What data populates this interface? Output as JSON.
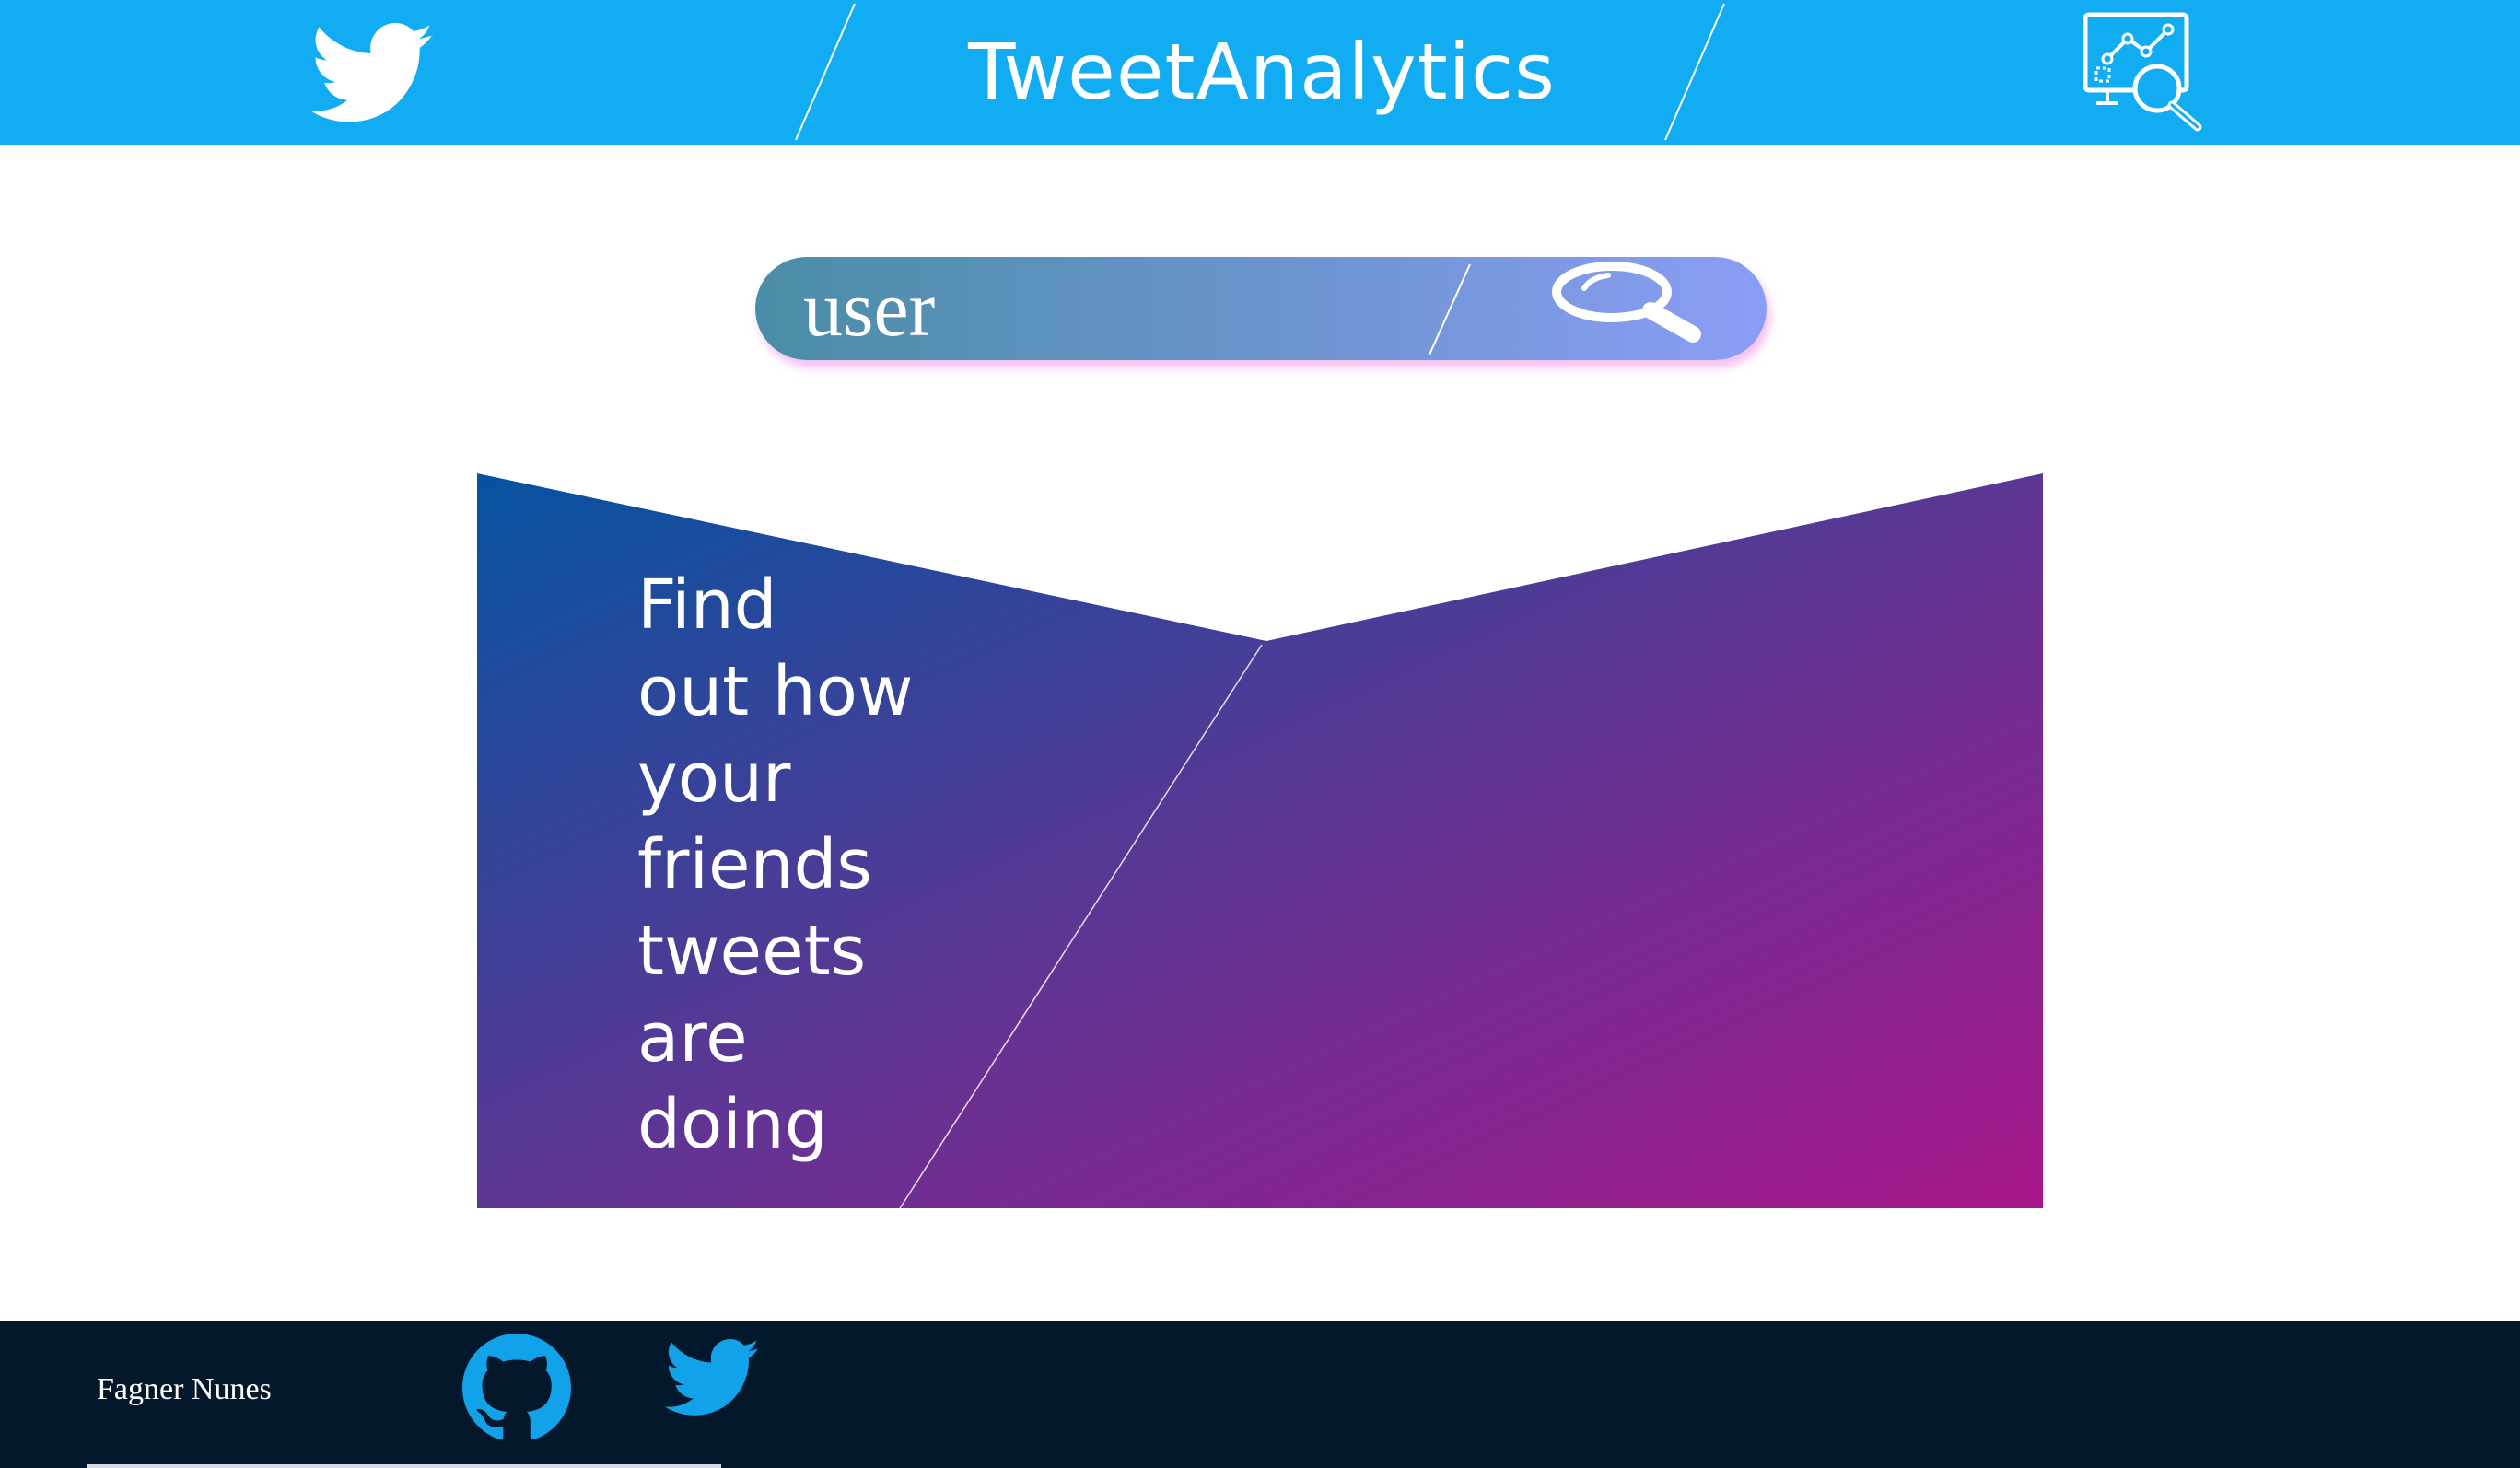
{
  "header": {
    "title": "TweetAnalytics",
    "logo_icon": "twitter-bird-icon",
    "right_icon": "analytics-magnifier-icon",
    "background": "#11acf2"
  },
  "search": {
    "placeholder": "user",
    "button_icon": "magnifier-icon"
  },
  "hero": {
    "tagline_lines": [
      "Find",
      "out how",
      "your",
      "friends",
      "tweets",
      "are",
      "doing"
    ],
    "gradient_start": "#0553a0",
    "gradient_end": "#a8168a"
  },
  "footer": {
    "author": "Fagner Nunes",
    "links": [
      {
        "icon": "github-icon"
      },
      {
        "icon": "twitter-bird-icon"
      }
    ],
    "background": "#03182a"
  }
}
